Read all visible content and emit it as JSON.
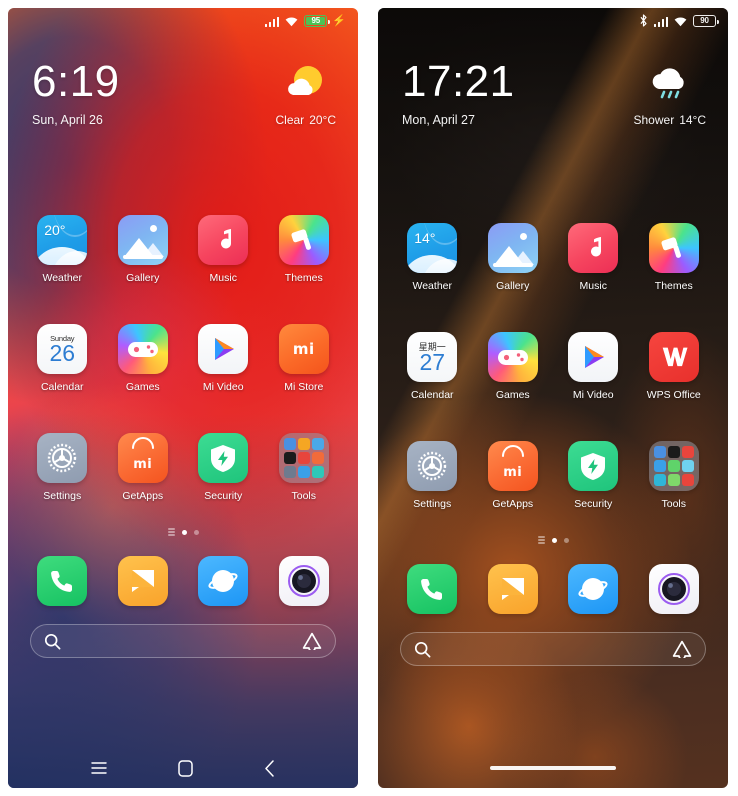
{
  "phones": [
    {
      "id": "left",
      "statusbar": {
        "bluetooth": false,
        "bluetooth_icon": "bluetooth-icon",
        "signal_icon": "signal-bars-icon",
        "wifi_icon": "wifi-icon",
        "battery_percent": "95",
        "battery_charging": true,
        "battery_color": "#4cc355",
        "charging_icon": "lightning-bolt-icon"
      },
      "clock": {
        "time": "6:19",
        "date": "Sun, April 26"
      },
      "weather": {
        "icon": "sun-behind-cloud-icon",
        "condition": "Clear",
        "temperature": "20°C"
      },
      "rows": [
        [
          {
            "label": "Weather",
            "icon": "weather-app-icon",
            "badge": "20°"
          },
          {
            "label": "Gallery",
            "icon": "gallery-app-icon"
          },
          {
            "label": "Music",
            "icon": "music-app-icon"
          },
          {
            "label": "Themes",
            "icon": "themes-app-icon"
          }
        ],
        [
          {
            "label": "Calendar",
            "icon": "calendar-app-icon",
            "weekday": "Sunday",
            "day": "26"
          },
          {
            "label": "Games",
            "icon": "games-app-icon"
          },
          {
            "label": "Mi Video",
            "icon": "mi-video-app-icon"
          },
          {
            "label": "Mi Store",
            "icon": "mi-store-app-icon",
            "wordmark": "mi"
          }
        ],
        [
          {
            "label": "Settings",
            "icon": "settings-app-icon"
          },
          {
            "label": "GetApps",
            "icon": "getapps-app-icon",
            "wordmark": "mi"
          },
          {
            "label": "Security",
            "icon": "security-app-icon"
          },
          {
            "label": "Tools",
            "icon": "tools-folder-icon"
          }
        ]
      ],
      "page_indicator": {
        "pages": 3,
        "active": 1,
        "has_list_marker": true
      },
      "dock": [
        {
          "label": "Phone",
          "icon": "phone-app-icon"
        },
        {
          "label": "Messages",
          "icon": "messages-app-icon"
        },
        {
          "label": "Browser",
          "icon": "browser-app-icon"
        },
        {
          "label": "Camera",
          "icon": "camera-app-icon"
        }
      ],
      "search": {
        "placeholder": "",
        "left_icon": "search-icon",
        "right_icon": "mi-assistant-icon"
      },
      "navigation": {
        "type": "three-button",
        "buttons": [
          {
            "name": "recents-button",
            "icon": "menu-lines-icon"
          },
          {
            "name": "home-button",
            "icon": "home-square-icon"
          },
          {
            "name": "back-button",
            "icon": "chevron-left-icon"
          }
        ]
      }
    },
    {
      "id": "right",
      "statusbar": {
        "bluetooth": true,
        "bluetooth_icon": "bluetooth-icon",
        "signal_icon": "signal-bars-icon",
        "wifi_icon": "wifi-icon",
        "battery_percent": "90",
        "battery_charging": false,
        "battery_color": "#ffffff",
        "charging_icon": ""
      },
      "clock": {
        "time": "17:21",
        "date": "Mon, April 27"
      },
      "weather": {
        "icon": "rain-cloud-icon",
        "condition": "Shower",
        "temperature": "14°C"
      },
      "rows": [
        [
          {
            "label": "Weather",
            "icon": "weather-app-icon",
            "badge": "14°"
          },
          {
            "label": "Gallery",
            "icon": "gallery-app-icon"
          },
          {
            "label": "Music",
            "icon": "music-app-icon"
          },
          {
            "label": "Themes",
            "icon": "themes-app-icon"
          }
        ],
        [
          {
            "label": "Calendar",
            "icon": "calendar-app-icon",
            "weekday": "星期一",
            "day": "27"
          },
          {
            "label": "Games",
            "icon": "games-app-icon"
          },
          {
            "label": "Mi Video",
            "icon": "mi-video-app-icon"
          },
          {
            "label": "WPS Office",
            "icon": "wps-office-app-icon",
            "wordmark": "W"
          }
        ],
        [
          {
            "label": "Settings",
            "icon": "settings-app-icon"
          },
          {
            "label": "GetApps",
            "icon": "getapps-app-icon",
            "wordmark": "mi"
          },
          {
            "label": "Security",
            "icon": "security-app-icon"
          },
          {
            "label": "Tools",
            "icon": "tools-folder-icon"
          }
        ]
      ],
      "page_indicator": {
        "pages": 3,
        "active": 1,
        "has_list_marker": true
      },
      "dock": [
        {
          "label": "Phone",
          "icon": "phone-app-icon"
        },
        {
          "label": "Messages",
          "icon": "messages-app-icon"
        },
        {
          "label": "Browser",
          "icon": "browser-app-icon"
        },
        {
          "label": "Camera",
          "icon": "camera-app-icon"
        }
      ],
      "search": {
        "placeholder": "",
        "left_icon": "search-icon",
        "right_icon": "mi-assistant-icon"
      },
      "navigation": {
        "type": "gesture-bar",
        "buttons": [
          {
            "name": "gesture-home-bar",
            "icon": "home-pill-icon"
          }
        ]
      }
    }
  ]
}
